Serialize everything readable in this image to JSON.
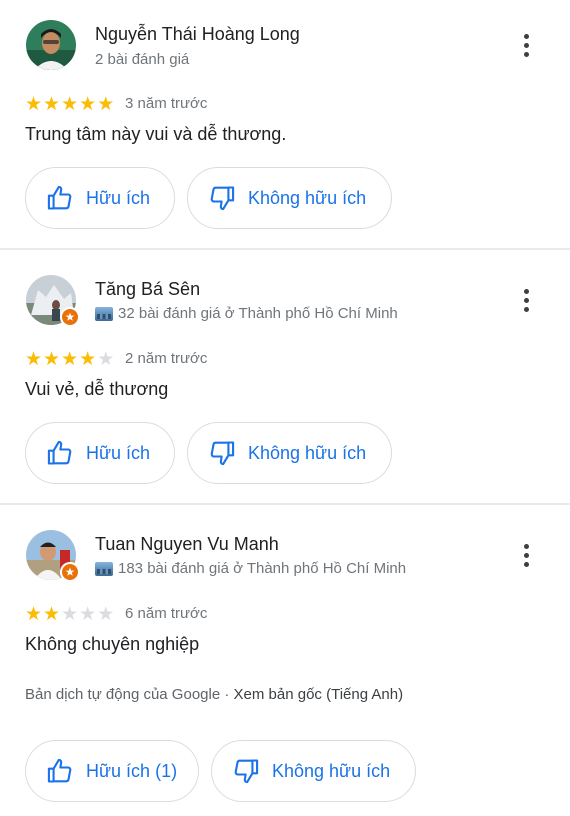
{
  "reviews": [
    {
      "name": "Nguyễn Thái Hoàng Long",
      "subtitle": "2 bài đánh giá",
      "local_guide": false,
      "rating": 5,
      "time": "3 năm trước",
      "text": "Trung tâm này vui và dễ thương.",
      "helpful_label": "Hữu ích",
      "unhelpful_label": "Không hữu ích"
    },
    {
      "name": "Tăng Bá Sên",
      "subtitle": "32 bài đánh giá ở Thành phố Hồ Chí Minh",
      "local_guide": true,
      "rating": 4,
      "time": "2 năm trước",
      "text": "Vui vẻ, dễ thương",
      "helpful_label": "Hữu ích",
      "unhelpful_label": "Không hữu ích"
    },
    {
      "name": "Tuan Nguyen Vu Manh",
      "subtitle": "183 bài đánh giá ở Thành phố Hồ Chí Minh",
      "local_guide": true,
      "rating": 2,
      "time": "6 năm trước",
      "text": "Không chuyên nghiệp",
      "translation_note": "Bản dịch tự động của Google",
      "translation_separator": " · ",
      "translation_link": "Xem bản gốc (Tiếng Anh)",
      "helpful_label": "Hữu ích (1)",
      "unhelpful_label": "Không hữu ích"
    }
  ],
  "icons": {
    "more": "more-vert-icon",
    "helpful": "thumb-up-icon",
    "unhelpful": "thumb-down-icon",
    "local_guide": "local-guide-badge-icon",
    "city": "city-icon"
  },
  "colors": {
    "accent": "#1a73e8",
    "star": "#fbbc04",
    "badge": "#e8710a"
  }
}
